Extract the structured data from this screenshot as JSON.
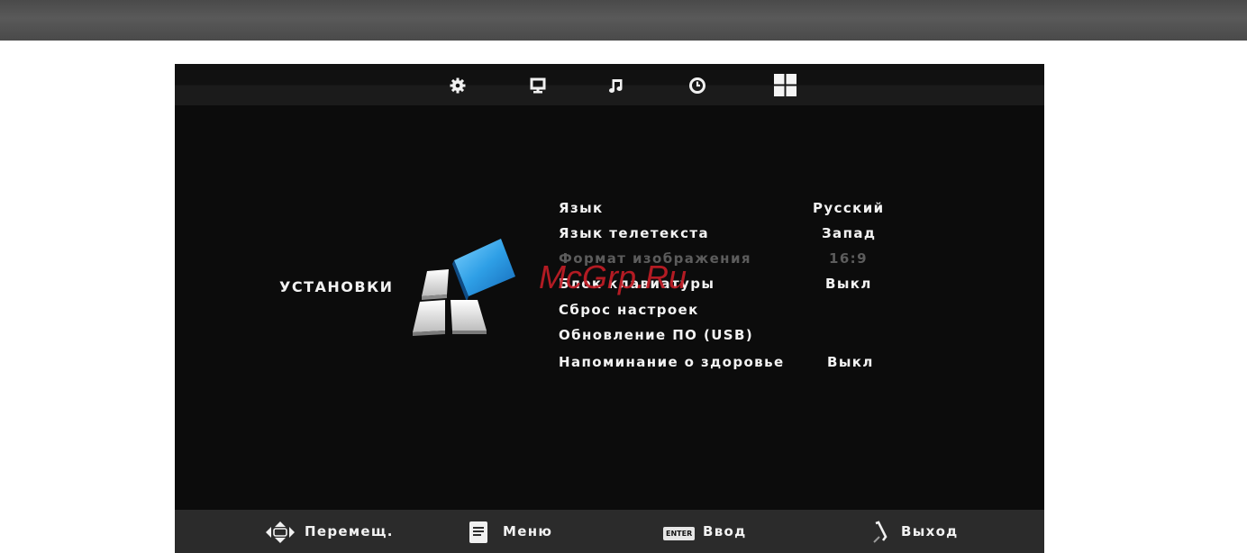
{
  "tabs": [
    {
      "icon": "gear-icon"
    },
    {
      "icon": "monitor-icon"
    },
    {
      "icon": "music-note-icon"
    },
    {
      "icon": "clock-icon"
    },
    {
      "icon": "grid-icon"
    }
  ],
  "section": {
    "title": "УСТАНОВКИ"
  },
  "menu": {
    "items": [
      {
        "label": "Язык",
        "value": "Русский"
      },
      {
        "label": "Язык телетекста",
        "value": "Запад"
      },
      {
        "label": "Формат изображения",
        "value": "16:9"
      },
      {
        "label": "Блок клавиатуры",
        "value": "Выкл"
      },
      {
        "label": "Сброс настроек",
        "value": ""
      },
      {
        "label": "Обновление ПО (USB)",
        "value": ""
      },
      {
        "label": "Напоминание о здоровье",
        "value": "Выкл"
      }
    ]
  },
  "watermark": "McGrp.Ru",
  "footer": {
    "move_label": "Перемещ.",
    "menu_label": "Меню",
    "enter_badge": "ENTER",
    "enter_label": "Ввод",
    "exit_label": "Выход"
  },
  "colors": {
    "background": "#0c0c0c",
    "footer": "#2b2b2b",
    "accent_blue": "#2e9fe6",
    "watermark": "#c21d26"
  }
}
